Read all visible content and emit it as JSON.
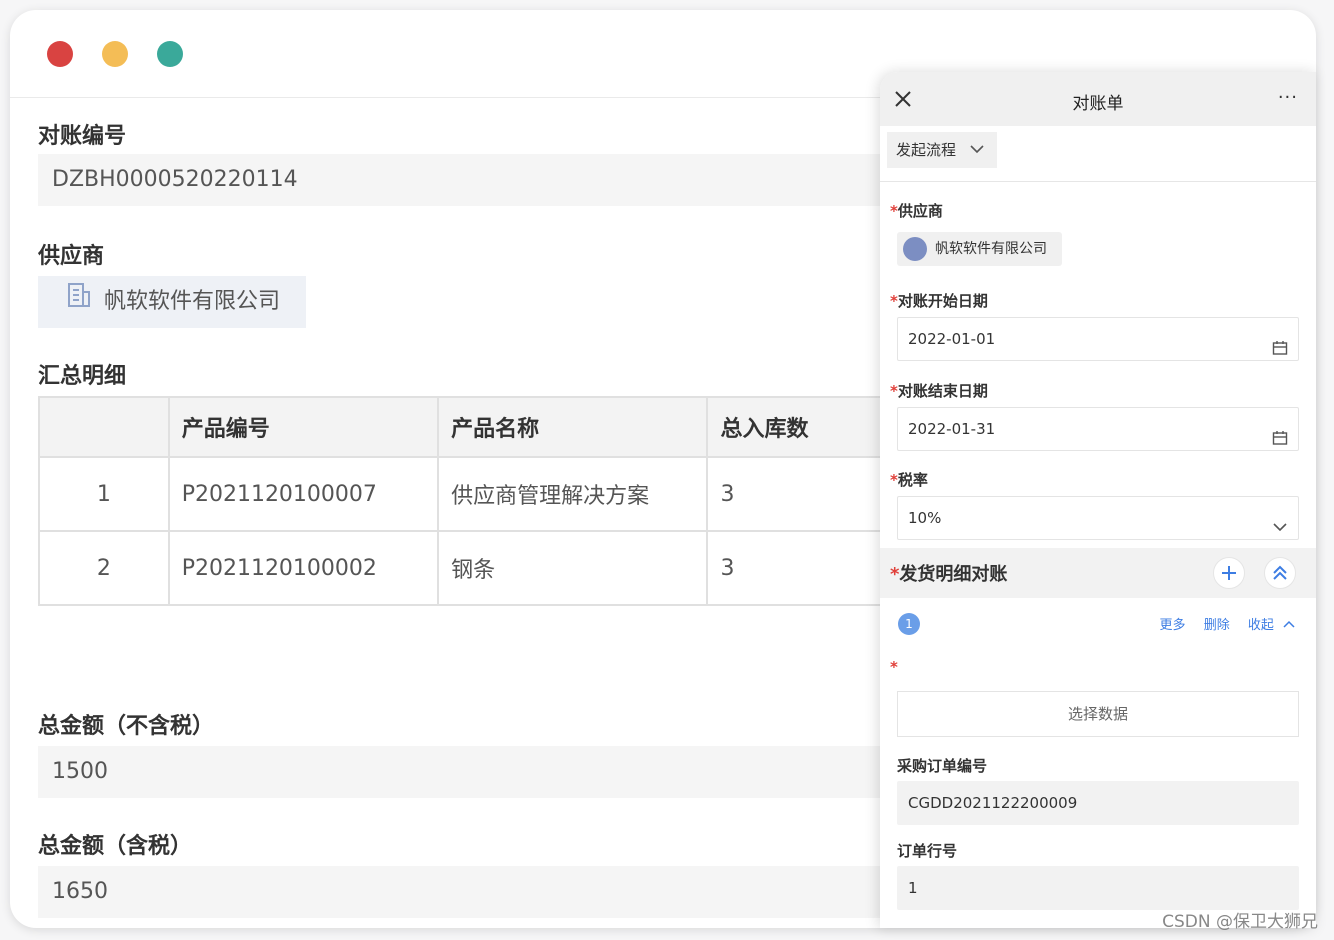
{
  "main": {
    "recon_no_label": "对账编号",
    "recon_no_value": "DZBH0000520220114",
    "supplier_label": "供应商",
    "supplier_value": "帆软软件有限公司",
    "summary_label": "汇总明细",
    "table": {
      "headers": [
        "",
        "产品编号",
        "产品名称",
        "总入库数"
      ],
      "rows": [
        [
          "1",
          "P2021120100007",
          "供应商管理解决方案",
          "3"
        ],
        [
          "2",
          "P2021120100002",
          "钢条",
          "3"
        ]
      ]
    },
    "total_ex_tax_label": "总金额（不含税）",
    "total_ex_tax_value": "1500",
    "total_inc_tax_label": "总金额（含税）",
    "total_inc_tax_value": "1650"
  },
  "panel": {
    "title": "对账单",
    "more": "···",
    "flow_button": "发起流程",
    "supplier_label": "供应商",
    "supplier_value": "帆软软件有限公司",
    "start_date_label": "对账开始日期",
    "start_date_value": "2022-01-01",
    "end_date_label": "对账结束日期",
    "end_date_value": "2022-01-31",
    "tax_label": "税率",
    "tax_value": "10%",
    "section_label": "发货明细对账",
    "badge": "1",
    "actions": [
      "更多",
      "删除",
      "收起"
    ],
    "select_data": "选择数据",
    "po_label": "采购订单编号",
    "po_value": "CGDD2021122200009",
    "line_label": "订单行号",
    "line_value": "1",
    "required_mark": "*"
  },
  "watermark": "CSDN @保卫大狮兄",
  "colors": {
    "close_dot": "#d94341",
    "minimize_dot": "#f4bd56",
    "maximize_dot": "#3aa99a",
    "accent": "#3d7de3",
    "required": "#e0403a"
  }
}
